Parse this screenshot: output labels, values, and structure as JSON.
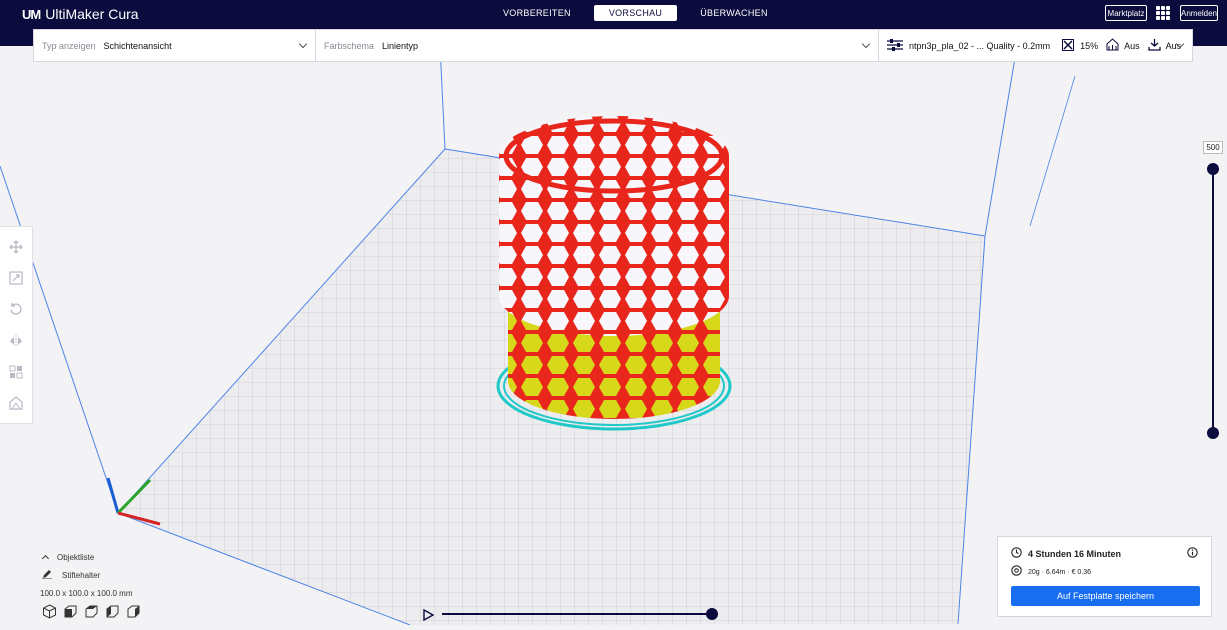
{
  "app": {
    "name": "UltiMaker Cura",
    "logo_mark": "UM"
  },
  "stages": [
    {
      "label": "VORBEREITEN",
      "active": false
    },
    {
      "label": "VORSCHAU",
      "active": true
    },
    {
      "label": "ÜBERWACHEN",
      "active": false
    }
  ],
  "topbar": {
    "marketplace_label": "Marktplatz",
    "signin_label": "Anmelden"
  },
  "view_type": {
    "label": "Typ anzeigen",
    "value": "Schichtenansicht"
  },
  "color_scheme": {
    "label": "Farbschema",
    "value": "Linientyp"
  },
  "print_settings": {
    "profile": "ntpn3p_pla_02 - ... Quality - 0.2mm",
    "infill": "15%",
    "support": "Aus",
    "adhesion": "Aus"
  },
  "layer": {
    "current": "500",
    "top_fraction": 1.0,
    "bottom_fraction": 0.0
  },
  "object_list": {
    "toggle_label": "Objektliste",
    "object_name": "Stiftehalter",
    "dimensions": "100.0 x 100.0 x 100.0 mm"
  },
  "simulation": {
    "progress": 1.0
  },
  "print_info": {
    "time": "4 Stunden 16 Minuten",
    "material": "20g · 6.64m · € 0.36",
    "save_label": "Auf Festplatte speichern"
  },
  "colors": {
    "topbar": "#0b0b3d",
    "accent": "#196ef0",
    "model_wall": "#e8261c",
    "model_infill": "#d8d81a",
    "model_skirt": "#20c8c8"
  },
  "icons": {
    "toolbar": [
      "move-icon",
      "scale-icon",
      "rotate-icon",
      "mirror-icon",
      "per-model-settings-icon",
      "support-blocker-icon"
    ],
    "view": [
      "3d-view-icon",
      "front-view-icon",
      "top-view-icon",
      "left-view-icon",
      "right-view-icon"
    ]
  }
}
